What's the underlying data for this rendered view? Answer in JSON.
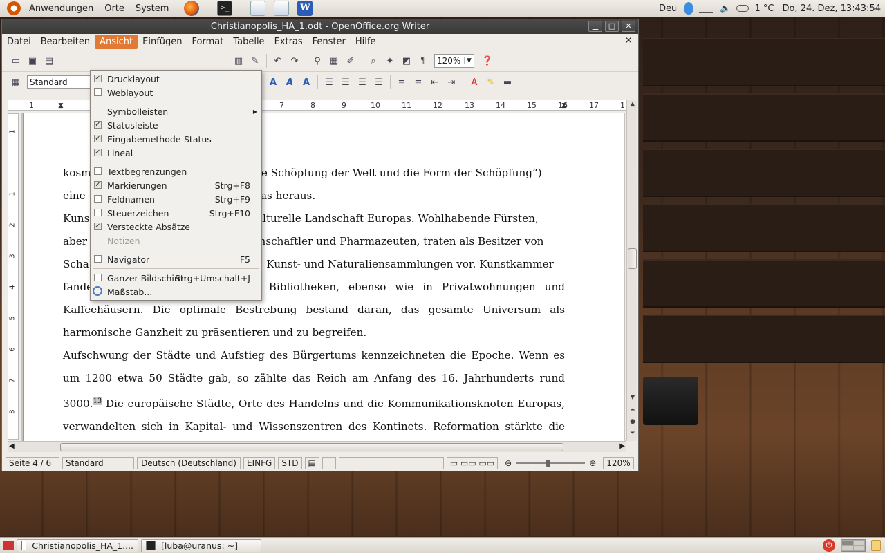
{
  "top_panel": {
    "menus": [
      "Anwendungen",
      "Orte",
      "System"
    ],
    "keyboard": "Deu",
    "weather": "1 °C",
    "clock": "Do, 24. Dez, 13:43:54"
  },
  "window": {
    "title": "Christianopolis_HA_1.odt - OpenOffice.org Writer",
    "menubar": [
      "Datei",
      "Bearbeiten",
      "Ansicht",
      "Einfügen",
      "Format",
      "Tabelle",
      "Extras",
      "Fenster",
      "Hilfe"
    ],
    "active_menu": "Ansicht",
    "zoom": "120%",
    "paragraph_style": "Standard"
  },
  "ruler": {
    "h_numbers": [
      "1",
      "7",
      "8",
      "9",
      "10",
      "11",
      "12",
      "13",
      "14",
      "15",
      "16",
      "17",
      "1"
    ],
    "v_numbers": [
      "1",
      "1",
      "2",
      "3",
      "4",
      "5",
      "6",
      "7",
      "8"
    ]
  },
  "ansicht_menu": {
    "items": [
      {
        "label": "Drucklayout",
        "checked": true,
        "shortcut": ""
      },
      {
        "label": "Weblayout",
        "checked": false,
        "shortcut": ""
      },
      {
        "sep": true
      },
      {
        "label": "Symbolleisten",
        "submenu": true
      },
      {
        "label": "Statusleiste",
        "checked": true,
        "shortcut": ""
      },
      {
        "label": "Eingabemethode-Status",
        "checked": true,
        "shortcut": ""
      },
      {
        "label": "Lineal",
        "checked": true,
        "shortcut": ""
      },
      {
        "sep": true
      },
      {
        "label": "Textbegrenzungen",
        "checked": false,
        "shortcut": ""
      },
      {
        "label": "Markierungen",
        "checked": true,
        "shortcut": "Strg+F8"
      },
      {
        "label": "Feldnamen",
        "checked": false,
        "shortcut": "Strg+F9"
      },
      {
        "label": "Steuerzeichen",
        "checked": false,
        "shortcut": "Strg+F10"
      },
      {
        "label": "Versteckte Absätze",
        "checked": true,
        "shortcut": ""
      },
      {
        "label": "Notizen",
        "disabled": true
      },
      {
        "sep": true
      },
      {
        "label": "Navigator",
        "checked": false,
        "shortcut": "F5"
      },
      {
        "sep": true
      },
      {
        "label": "Ganzer Bildschirm",
        "checked": false,
        "shortcut": "Strg+Umschalt+J"
      },
      {
        "label": "Maßstab...",
        "icon": "magnifier-icon"
      }
    ]
  },
  "document": {
    "lines": [
      "kosm                                                die Schöpfung der Welt und die Form der Schöpfung“)",
      "eine                                                Atlas heraus.",
      "Kuns                                                kulturelle Landschaft Europas. Wohlhabende Fürsten,",
      "aber                                                senschaftler und Pharmazeuten, traten als Besitzer von",
      "Scha                                                te, Kunst- und Naturaliensammlungen vor. Kunstkammer",
      "fanden sich in Universitäten und Bibliotheken, ebenso wie in Privatwohnungen und",
      "Kaffeehäusern. Die optimale Bestrebung  bestand daran, das gesamte Universum als",
      "harmonische Ganzheit zu präsentieren und zu begreifen.",
      "Aufschwung der Städte und Aufstieg des Bürgertums kennzeichneten die Epoche. Wenn es",
      "um 1200 etwa 50 Städte gab, so zählte das Reich am Anfang des 16. Jahrhunderts rund",
      "3000.",
      "Die europäische Städte, Orte des Handelns und die Kommunikationsknoten Europas,",
      "verwandelten sich in Kapital- und Wissenszentren des Kontinets. Reformation stärkte die"
    ],
    "footnote": "13"
  },
  "statusbar": {
    "page": "Seite 4 / 6",
    "style": "Standard",
    "language": "Deutsch (Deutschland)",
    "insert_mode": "EINFG",
    "selection_mode": "STD",
    "zoom": "120%"
  },
  "taskbar": {
    "tasks": [
      "Christianopolis_HA_1....",
      "[luba@uranus: ~]"
    ]
  }
}
